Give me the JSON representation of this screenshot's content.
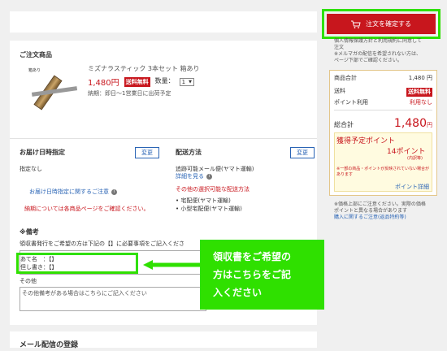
{
  "header": {
    "confirm_label": "注文を確定する"
  },
  "notice": {
    "line1": "個人情報保護方針と利用規約に同意して",
    "line2": "注文",
    "line3": "※メルマガの配信を希望されない方は、",
    "line4": "ページ下部でご確認ください。"
  },
  "order_items": {
    "title": "ご注文商品",
    "thumb_label": "箱あり",
    "name": "ミズナラスティック 3本セット 箱あり",
    "price": "1,480円",
    "free_shipping": "送料無料",
    "qty_label": "数量：",
    "qty_value": "1",
    "delivery_note": "納期：即日〜1営業日に出荷予定"
  },
  "delivery_date": {
    "title": "お届け日時指定",
    "change_label": "変更",
    "value": "指定なし",
    "info_link": "お届け日時指定に関するご注意",
    "note": "納期については各商品ページをご確認ください。"
  },
  "shipping": {
    "title": "配送方法",
    "change_label": "変更",
    "method": "追跡可能メール便(ヤマト運輸)",
    "details_link": "詳細を見る",
    "other_title": "その他の選択可能な配送方法",
    "options": [
      "宅配便(ヤマト運輸)",
      "小型宅配便(ヤマト運輸)"
    ]
  },
  "remarks": {
    "title": "※備考",
    "instruction": "領収書発行をご希望の方は下記の【】に必要事項をご記入くださ",
    "line1": "あて名　：【】",
    "line2": "但し書き：【】",
    "other_label": "その他",
    "other_placeholder": "その他備考がある場合はこちらにご記入ください"
  },
  "callout": {
    "line1": "領収書をご希望の",
    "line2": "方はこちらをご記",
    "line3": "入ください"
  },
  "summary": {
    "subtotal_label": "商品合計",
    "subtotal_value": "1,480 円",
    "shipping_label": "送料",
    "shipping_value": "送料無料",
    "points_label": "ポイント利用",
    "points_value": "利用なし",
    "total_label": "総合計",
    "total_value": "1,480",
    "total_unit": "円"
  },
  "points_box": {
    "title": "獲得予定ポイント",
    "value": "14ポイント",
    "sub": "(内訳等)",
    "note": "※一部の商品・ポイントが反映されていない場合があります",
    "link": "ポイント詳細"
  },
  "footer_note": {
    "line1": "※価格上部にご注意ください。実際の価格",
    "line2": "ポイントと異なる場合があります",
    "link": "購入に関するご注意(返品特約等)"
  },
  "bottom_card": {
    "title": "メール配信の登録"
  },
  "colors": {
    "accent_red": "#c8161d",
    "callout_green": "#2fe000",
    "link_blue": "#2a64b5"
  }
}
